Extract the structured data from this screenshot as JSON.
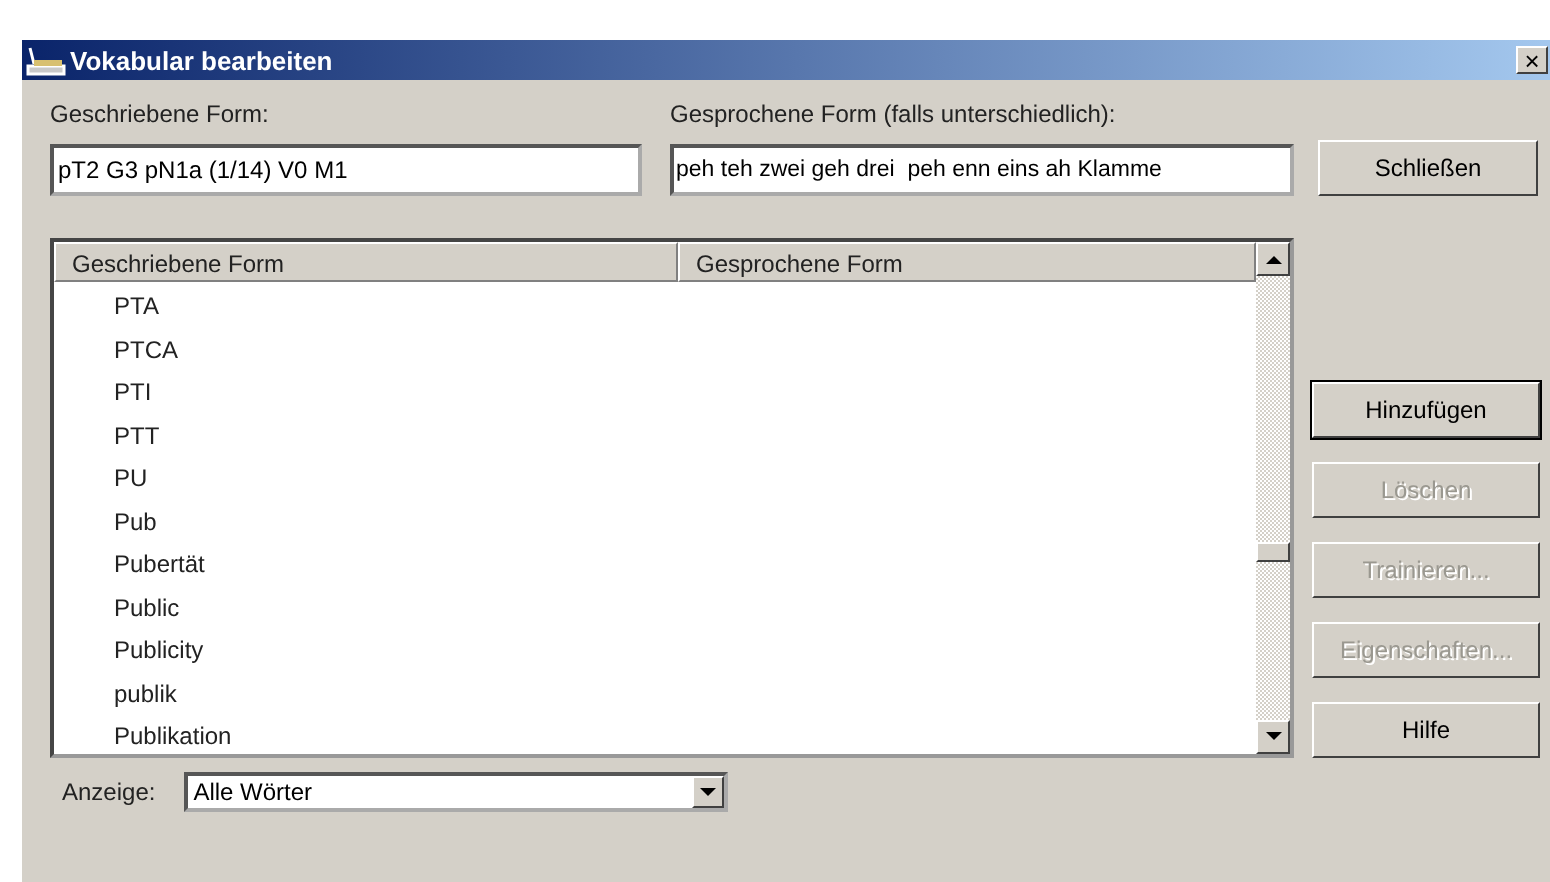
{
  "window": {
    "title": "Vokabular bearbeiten",
    "close": "×"
  },
  "written_field": {
    "label": "Geschriebene Form:",
    "value": "pT2 G3 pN1a (1/14) V0 M1"
  },
  "spoken_field": {
    "label": "Gesprochene Form (falls unterschiedlich):",
    "value": "peh teh zwei geh drei  peh enn eins ah Klamme"
  },
  "close_button": {
    "label": "Schließen",
    "disabled": false
  },
  "table": {
    "columns": [
      "Geschriebene Form",
      "Gesprochene Form"
    ],
    "rows": [
      {
        "written": "PTA"
      },
      {
        "written": "PTCA"
      },
      {
        "written": "PTI"
      },
      {
        "written": "PTT"
      },
      {
        "written": "PU"
      },
      {
        "written": "Pub"
      },
      {
        "written": "Pubertät"
      },
      {
        "written": "Public"
      },
      {
        "written": "Publicity"
      },
      {
        "written": "publik"
      },
      {
        "written": "Publikation"
      }
    ]
  },
  "buttons": [
    {
      "label": "Hinzufügen",
      "disabled": false
    },
    {
      "label": "Löschen",
      "disabled": true
    },
    {
      "label": "Trainieren...",
      "disabled": true
    },
    {
      "label": "Eigenschaften...",
      "disabled": true
    },
    {
      "label": "Hilfe",
      "disabled": false
    }
  ],
  "display": {
    "label": "Anzeige:",
    "value": "Alle Wörter"
  }
}
